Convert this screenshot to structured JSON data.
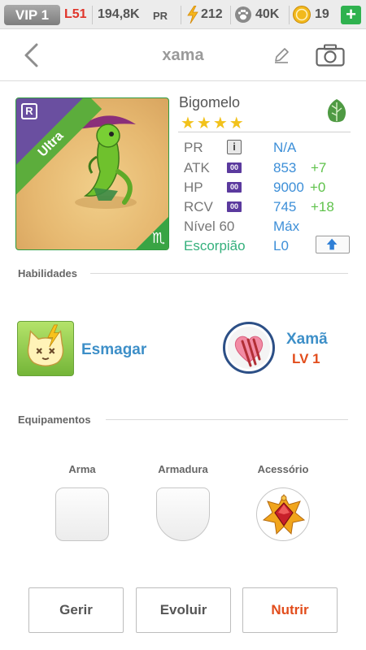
{
  "status_bar": {
    "vip": "VIP 1",
    "level": "L51",
    "power": "194,8K",
    "power_unit": "PR",
    "energy": "212",
    "paws": "40K",
    "coins": "19",
    "add_label": "+"
  },
  "nav": {
    "title": "xama",
    "icons": [
      "back-icon",
      "edit-icon",
      "camera-icon"
    ]
  },
  "monster": {
    "name": "Bigomelo",
    "stars": "★★★★",
    "rarity_badge": "R",
    "rarity": "Ultra",
    "element_icon": "leaf-icon",
    "zodiac_glyph": "♏",
    "stats": [
      {
        "label": "PR",
        "value": "N/A",
        "bonus": ""
      },
      {
        "label": "ATK",
        "tag": "00",
        "value": "853",
        "bonus": "+7"
      },
      {
        "label": "HP",
        "tag": "00",
        "value": "9000",
        "bonus": "+0"
      },
      {
        "label": "RCV",
        "tag": "00",
        "value": "745",
        "bonus": "+18"
      },
      {
        "label": "Nível 60",
        "value": "Máx",
        "bonus": ""
      },
      {
        "label": "Escorpião",
        "value": "L0",
        "bonus": ""
      }
    ],
    "info_label": "i",
    "colors": {
      "stat_value": "#3d8fd8",
      "bonus": "#5fc24b",
      "sign": "#34b07c"
    }
  },
  "abilities": {
    "title": "Habilidades",
    "skill": {
      "name": "Esmagar",
      "icon": "cat-face-icon"
    },
    "leader": {
      "name": "Xamã",
      "level": "LV 1",
      "icon": "heart-claw-icon"
    }
  },
  "equipment": {
    "title": "Equipamentos",
    "slots": [
      {
        "label": "Arma",
        "icon": "empty-slot"
      },
      {
        "label": "Armadura",
        "icon": "empty-slot"
      },
      {
        "label": "Acessório",
        "icon": "red-gem-icon"
      }
    ]
  },
  "actions": {
    "manage": "Gerir",
    "evolve": "Evoluir",
    "feed": "Nutrir"
  }
}
